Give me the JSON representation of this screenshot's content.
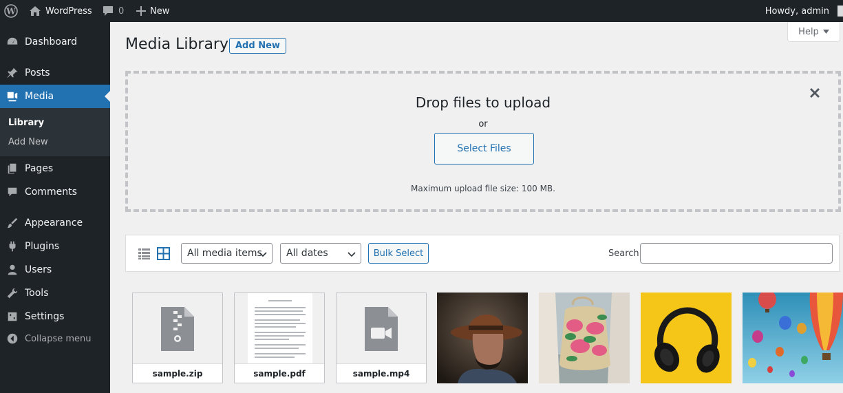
{
  "adminbar": {
    "site_name": "WordPress",
    "comments_count": "0",
    "new_label": "New",
    "howdy": "Howdy, admin"
  },
  "sidebar": {
    "items": [
      {
        "label": "Dashboard",
        "icon": "dashboard-icon"
      },
      {
        "label": "Posts",
        "icon": "pin-icon"
      },
      {
        "label": "Media",
        "icon": "media-icon"
      },
      {
        "label": "Pages",
        "icon": "pages-icon"
      },
      {
        "label": "Comments",
        "icon": "comment-icon"
      },
      {
        "label": "Appearance",
        "icon": "paintbrush-icon"
      },
      {
        "label": "Plugins",
        "icon": "plugin-icon"
      },
      {
        "label": "Users",
        "icon": "users-icon"
      },
      {
        "label": "Tools",
        "icon": "wrench-icon"
      },
      {
        "label": "Settings",
        "icon": "settings-icon"
      }
    ],
    "submenu": [
      "Library",
      "Add New"
    ],
    "collapse_label": "Collapse menu"
  },
  "help_label": "Help",
  "page": {
    "title": "Media Library",
    "add_new_label": "Add New"
  },
  "uploader": {
    "title": "Drop files to upload",
    "or": "or",
    "select_files": "Select Files",
    "max_size": "Maximum upload file size: 100 MB."
  },
  "toolbar": {
    "type_filter": "All media items",
    "date_filter": "All dates",
    "bulk_select": "Bulk Select",
    "search_label": "Search",
    "search_value": ""
  },
  "attachments": [
    {
      "filename": "sample.zip",
      "kind": "archive-file-icon"
    },
    {
      "filename": "sample.pdf",
      "kind": "document-thumbnail"
    },
    {
      "filename": "sample.mp4",
      "kind": "video-file-icon"
    },
    {
      "kind": "photo-man-with-hat"
    },
    {
      "kind": "photo-watermelon-bag"
    },
    {
      "kind": "photo-headphones"
    },
    {
      "kind": "photo-hot-air-balloons"
    }
  ],
  "colors": {
    "admin_bg": "#1d2327",
    "accent": "#2271b1",
    "page_bg": "#f0f0f1",
    "headphone_yellow": "#f5c518"
  }
}
